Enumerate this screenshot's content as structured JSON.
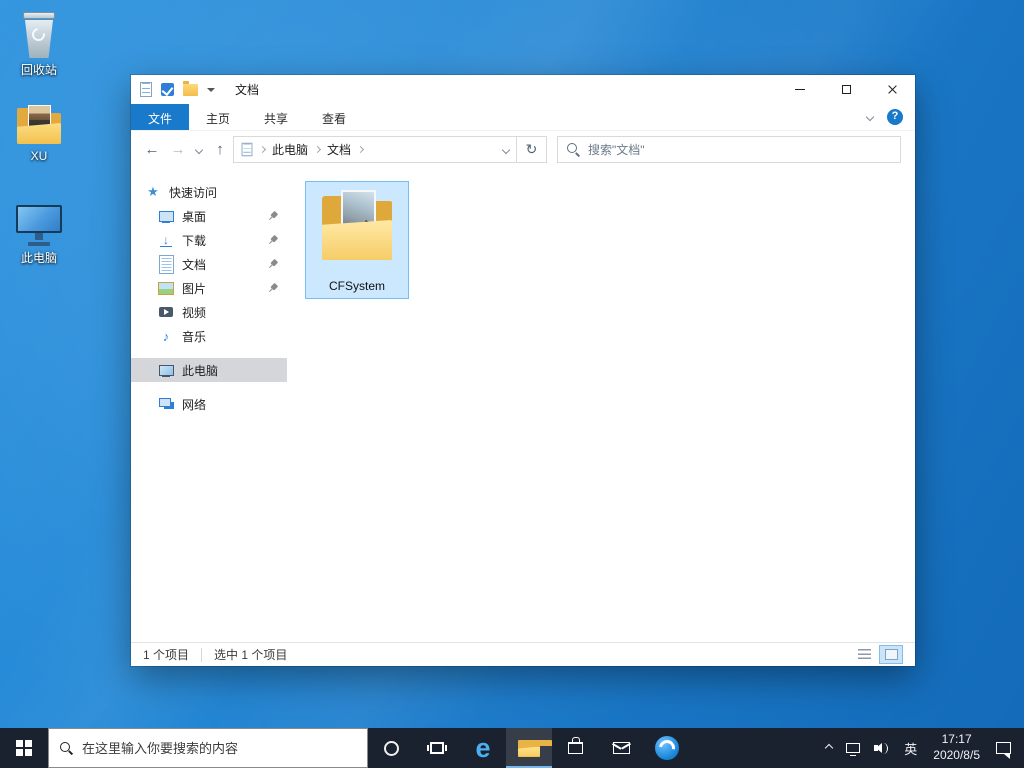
{
  "desktop": {
    "icons": [
      {
        "label": "回收站"
      },
      {
        "label": "XU"
      },
      {
        "label": "此电脑"
      }
    ]
  },
  "window": {
    "title": "文档",
    "tabs": [
      {
        "label": "文件"
      },
      {
        "label": "主页"
      },
      {
        "label": "共享"
      },
      {
        "label": "查看"
      }
    ],
    "nav": {
      "back": "←",
      "forward": "→",
      "up": "↑",
      "refresh": "↻"
    },
    "address": {
      "crumbs": [
        {
          "label": "此电脑"
        },
        {
          "label": "文档"
        }
      ]
    },
    "search": {
      "placeholder": "搜索\"文档\""
    },
    "sidebar": {
      "items": [
        {
          "label": "快速访问"
        },
        {
          "label": "桌面"
        },
        {
          "label": "下载"
        },
        {
          "label": "文档"
        },
        {
          "label": "图片"
        },
        {
          "label": "视频"
        },
        {
          "label": "音乐"
        },
        {
          "label": "此电脑"
        },
        {
          "label": "网络"
        }
      ]
    },
    "files": [
      {
        "label": "CFSystem"
      }
    ],
    "status": {
      "item_count": "1 个项目",
      "selected_count": "选中 1 个项目"
    }
  },
  "taskbar": {
    "search_placeholder": "在这里输入你要搜索的内容",
    "ime_label": "英",
    "clock": {
      "time": "17:17",
      "date": "2020/8/5"
    }
  },
  "colors": {
    "accent": "#1979ca",
    "selection": "#cce8ff",
    "taskbar": "#1a2230"
  }
}
